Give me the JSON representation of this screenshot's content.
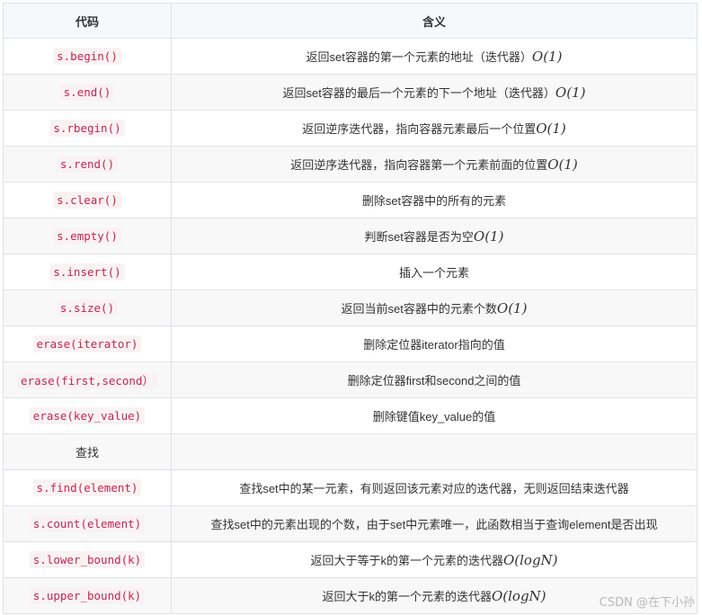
{
  "table": {
    "headers": [
      "代码",
      "含义"
    ],
    "rows": [
      {
        "code": "s.begin()",
        "code_style": "code",
        "desc": "返回set容器的第一个元素的地址（迭代器）",
        "complexity": "O(1)"
      },
      {
        "code": "s.end()",
        "code_style": "code",
        "desc": "返回set容器的最后一个元素的下一个地址（迭代器）",
        "complexity": "O(1)"
      },
      {
        "code": "s.rbegin()",
        "code_style": "code",
        "desc": "返回逆序迭代器，指向容器元素最后一个位置",
        "complexity": "O(1)"
      },
      {
        "code": "s.rend()",
        "code_style": "code",
        "desc": "返回逆序迭代器，指向容器第一个元素前面的位置",
        "complexity": "O(1)"
      },
      {
        "code": "s.clear()",
        "code_style": "code",
        "desc": "删除set容器中的所有的元素",
        "complexity": ""
      },
      {
        "code": "s.empty()",
        "code_style": "code",
        "desc": "判断set容器是否为空",
        "complexity": "O(1)"
      },
      {
        "code": "s.insert()",
        "code_style": "code",
        "desc": "插入一个元素",
        "complexity": ""
      },
      {
        "code": "s.size()",
        "code_style": "code",
        "desc": "返回当前set容器中的元素个数",
        "complexity": "O(1)"
      },
      {
        "code": "erase(iterator)",
        "code_style": "code",
        "desc": "删除定位器iterator指向的值",
        "complexity": ""
      },
      {
        "code": "erase(first,second）",
        "code_style": "code",
        "desc": "删除定位器first和second之间的值",
        "complexity": ""
      },
      {
        "code": "erase(key_value)",
        "code_style": "code",
        "desc": "删除键值key_value的值",
        "complexity": ""
      },
      {
        "code": "查找",
        "code_style": "plain",
        "desc": "",
        "complexity": ""
      },
      {
        "code": "s.find(element)",
        "code_style": "code",
        "desc": "查找set中的某一元素，有则返回该元素对应的迭代器，无则返回结束迭代器",
        "complexity": ""
      },
      {
        "code": "s.count(element)",
        "code_style": "code",
        "desc": "查找set中的元素出现的个数，由于set中元素唯一，此函数相当于查询element是否出现",
        "complexity": ""
      },
      {
        "code": "s.lower_bound(k)",
        "code_style": "code",
        "desc": "返回大于等于k的第一个元素的迭代器",
        "complexity": "O(logN)"
      },
      {
        "code": "s.upper_bound(k)",
        "code_style": "code",
        "desc": "返回大于k的第一个元素的迭代器",
        "complexity": "O(logN)"
      }
    ]
  },
  "watermark": "CSDN @在下小孙"
}
